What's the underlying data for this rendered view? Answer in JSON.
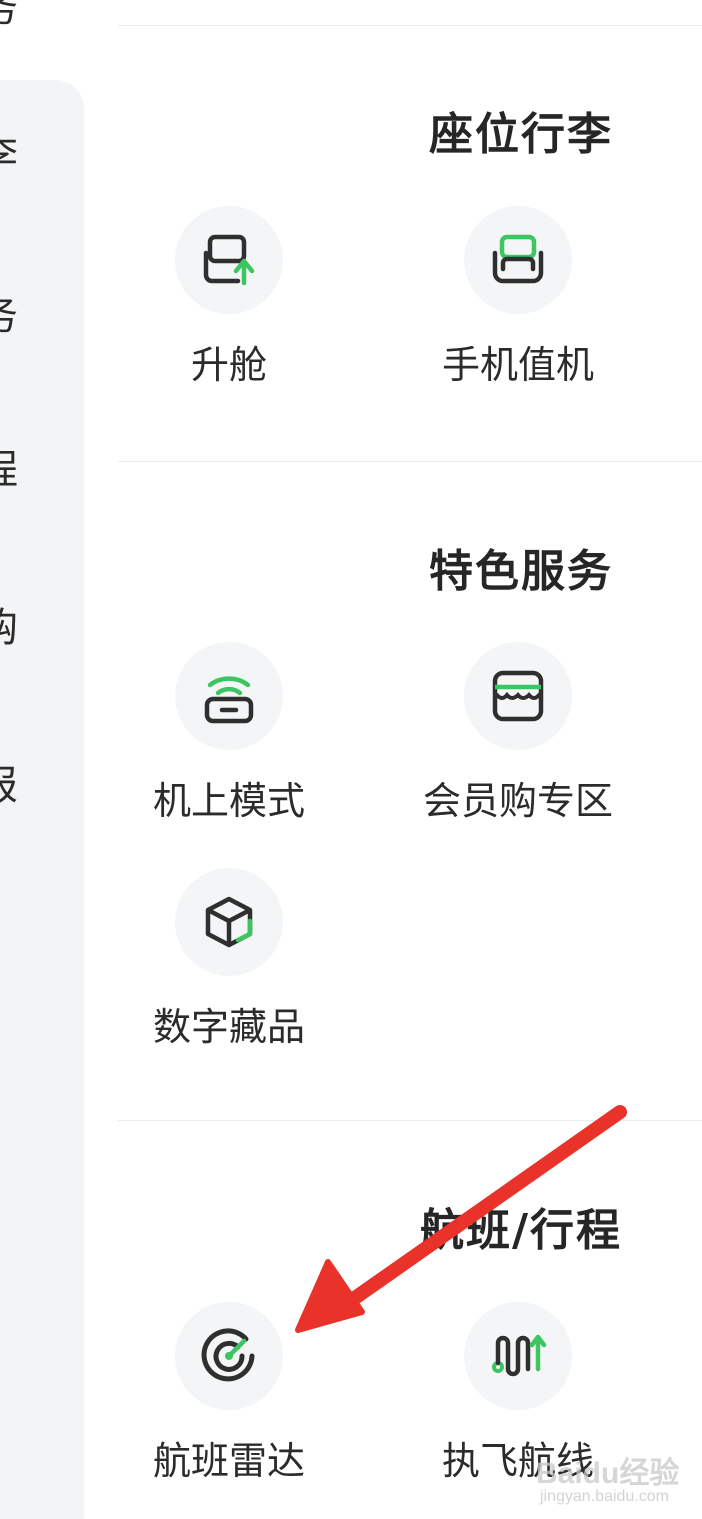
{
  "sidebar": {
    "header_fragment": "务",
    "items": [
      {
        "label": "李"
      },
      {
        "label": "务"
      },
      {
        "label": "程"
      },
      {
        "label": "购"
      },
      {
        "label": "报"
      }
    ]
  },
  "sections": [
    {
      "title": "座位行李",
      "items": [
        {
          "label": "升舱",
          "icon": "seat-upgrade-icon"
        },
        {
          "label": "手机值机",
          "icon": "seat-checkin-icon"
        }
      ]
    },
    {
      "title": "特色服务",
      "items": [
        {
          "label": "机上模式",
          "icon": "wifi-router-icon"
        },
        {
          "label": "会员购专区",
          "icon": "store-icon"
        },
        {
          "label": "数字藏品",
          "icon": "cube-icon"
        }
      ]
    },
    {
      "title": "航班/行程",
      "items": [
        {
          "label": "航班雷达",
          "icon": "radar-icon"
        },
        {
          "label": "执飞航线",
          "icon": "route-icon"
        }
      ]
    }
  ],
  "watermark": {
    "text": "Baidu经验",
    "sub": "jingyan.baidu.com"
  },
  "colors": {
    "accent": "#3cc561",
    "icon_dark": "#2f2f2f",
    "arrow": "#e8322a",
    "sidebar_bg": "#f3f4f6"
  }
}
